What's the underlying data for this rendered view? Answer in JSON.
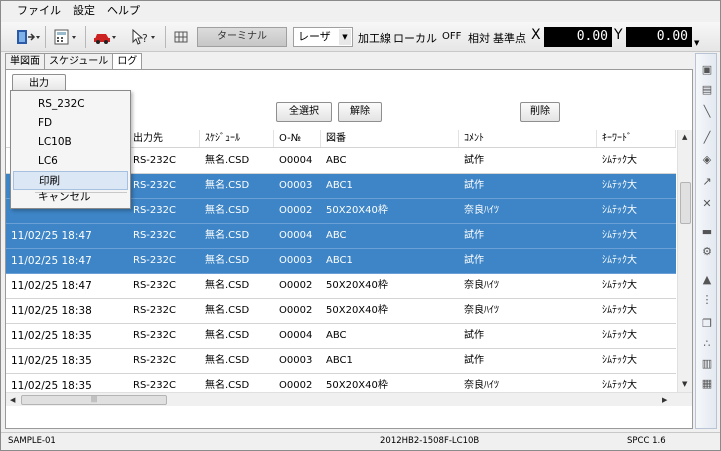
{
  "menu": [
    "ファイル",
    "設定",
    "ヘルプ"
  ],
  "toolbar": {
    "terminal": "ターミナル",
    "laser": "レーザ",
    "processing_line": "加工線",
    "local": "ローカル",
    "off": "OFF",
    "relative": "相対",
    "base_point": "基準点",
    "x_label": "X",
    "x_value": "0.00",
    "y_label": "Y",
    "y_value": "0.00"
  },
  "tabs": [
    "単図面",
    "スケジュール",
    "ログ"
  ],
  "buttons": {
    "output": "出力",
    "select_all": "全選択",
    "deselect": "解除",
    "delete": "削除"
  },
  "dropdown": [
    "RS_232C",
    "FD",
    "LC10B",
    "LC6",
    "印刷",
    "キャンセル"
  ],
  "columns": [
    "",
    "出力先",
    "ｽｹｼﾞｭｰﾙ",
    "O-№",
    "図番",
    "ｺﾒﾝﾄ",
    "ｷｰﾜｰﾄﾞ"
  ],
  "rows": [
    {
      "date": "",
      "dest": "RS-232C",
      "sched": "無名.CSD",
      "ono": "O0004",
      "zuban": "ABC",
      "comment": "試作",
      "keyword": "ｼﾑﾃｯｸ大",
      "selected": false
    },
    {
      "date": "",
      "dest": "RS-232C",
      "sched": "無名.CSD",
      "ono": "O0003",
      "zuban": "ABC1",
      "comment": "試作",
      "keyword": "ｼﾑﾃｯｸ大",
      "selected": true
    },
    {
      "date": "",
      "dest": "RS-232C",
      "sched": "無名.CSD",
      "ono": "O0002",
      "zuban": "50X20X40枠",
      "comment": "奈良ﾊｲﾂ",
      "keyword": "ｼﾑﾃｯｸ大",
      "selected": true
    },
    {
      "date": "11/02/25 18:47",
      "dest": "RS-232C",
      "sched": "無名.CSD",
      "ono": "O0004",
      "zuban": "ABC",
      "comment": "試作",
      "keyword": "ｼﾑﾃｯｸ大",
      "selected": true
    },
    {
      "date": "11/02/25 18:47",
      "dest": "RS-232C",
      "sched": "無名.CSD",
      "ono": "O0003",
      "zuban": "ABC1",
      "comment": "試作",
      "keyword": "ｼﾑﾃｯｸ大",
      "selected": true
    },
    {
      "date": "11/02/25 18:47",
      "dest": "RS-232C",
      "sched": "無名.CSD",
      "ono": "O0002",
      "zuban": "50X20X40枠",
      "comment": "奈良ﾊｲﾂ",
      "keyword": "ｼﾑﾃｯｸ大",
      "selected": false
    },
    {
      "date": "11/02/25 18:38",
      "dest": "RS-232C",
      "sched": "無名.CSD",
      "ono": "O0002",
      "zuban": "50X20X40枠",
      "comment": "奈良ﾊｲﾂ",
      "keyword": "ｼﾑﾃｯｸ大",
      "selected": false
    },
    {
      "date": "11/02/25 18:35",
      "dest": "RS-232C",
      "sched": "無名.CSD",
      "ono": "O0004",
      "zuban": "ABC",
      "comment": "試作",
      "keyword": "ｼﾑﾃｯｸ大",
      "selected": false
    },
    {
      "date": "11/02/25 18:35",
      "dest": "RS-232C",
      "sched": "無名.CSD",
      "ono": "O0003",
      "zuban": "ABC1",
      "comment": "試作",
      "keyword": "ｼﾑﾃｯｸ大",
      "selected": false
    },
    {
      "date": "11/02/25 18:35",
      "dest": "RS-232C",
      "sched": "無名.CSD",
      "ono": "O0002",
      "zuban": "50X20X40枠",
      "comment": "奈良ﾊｲﾂ",
      "keyword": "ｼﾑﾃｯｸ大",
      "selected": false
    }
  ],
  "status": {
    "left": "SAMPLE-01",
    "center": "2012HB2-1508F-LC10B",
    "right": "SPCC 1.6"
  },
  "colors": {
    "selection": "#3d85c6",
    "coord_bg": "#000000"
  },
  "icons": [
    "door-exit-icon",
    "calculator-icon",
    "car-icon",
    "cursor-help-icon",
    "grid-icon"
  ],
  "sidebar_icons": [
    "scanner-icon",
    "printer-icon",
    "line-icon",
    "line-icon",
    "chain-icon",
    "arrow-icon",
    "tools-icon",
    "gear-icon",
    "cone-icon",
    "layers-icon",
    "nodes-icon",
    "document-icon"
  ]
}
